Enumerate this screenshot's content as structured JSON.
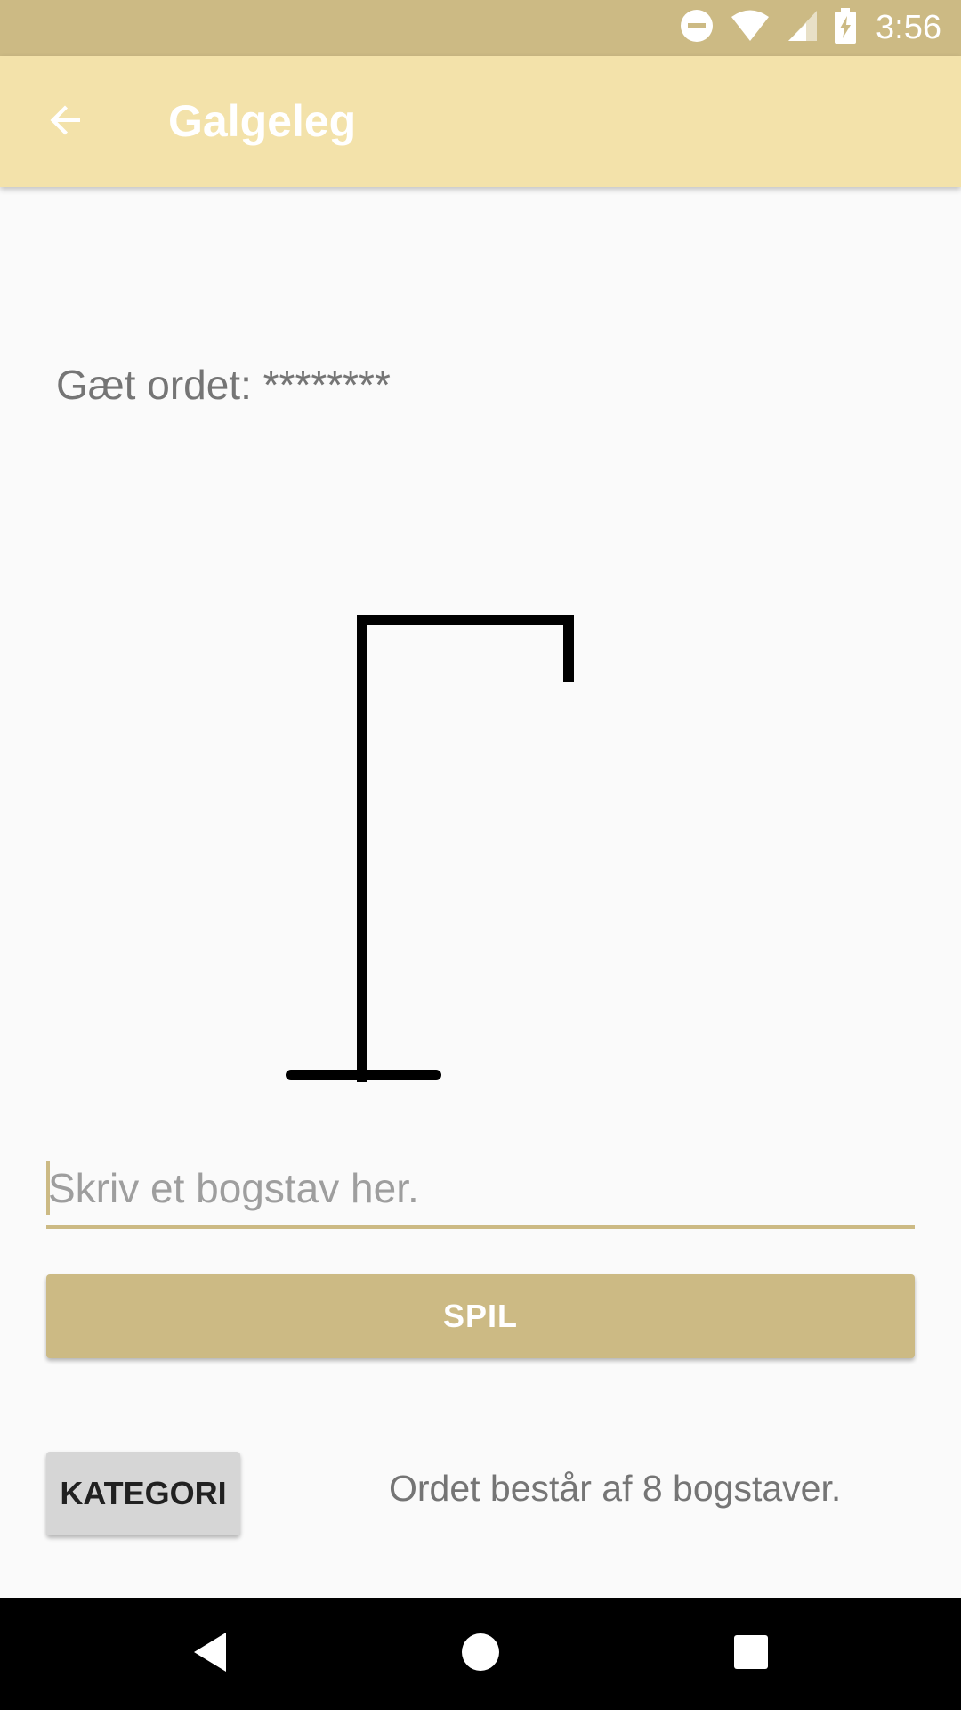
{
  "status_bar": {
    "time": "3:56",
    "icons": [
      "do-not-disturb-icon",
      "wifi-icon",
      "cell-signal-icon",
      "battery-charging-icon"
    ],
    "background": "#CCBA84"
  },
  "app_bar": {
    "title": "Galgeleg",
    "back_icon": "arrow-back-icon",
    "background": "#F3E2AA"
  },
  "game": {
    "guess_label": "Gæt ordet: ********",
    "hangman_stage": "gallows-only",
    "input_placeholder": "Skriv et bogstav her.",
    "input_value": "",
    "play_button": "SPIL",
    "category_button": "KATEGORI",
    "word_length_text": "Ordet består af 8 bogstaver."
  },
  "accent_color": "#CCBA84",
  "nav_bar": {
    "buttons": [
      "back-triangle-icon",
      "home-circle-icon",
      "recents-square-icon"
    ]
  }
}
